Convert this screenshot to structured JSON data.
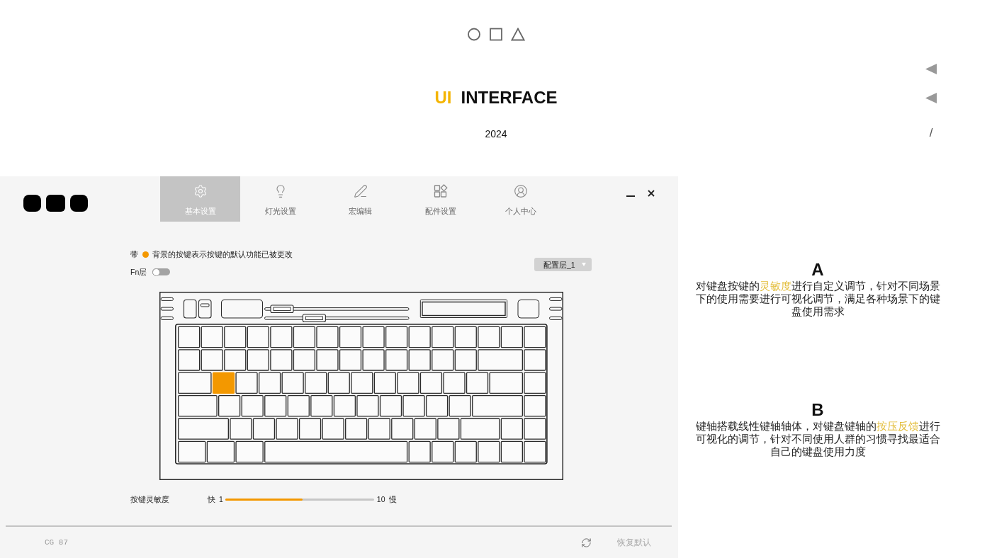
{
  "header": {
    "title_accent": "UI",
    "title": "INTERFACE",
    "year": "2024",
    "side_mark": "/"
  },
  "app": {
    "tabs": [
      {
        "label": "基本设置",
        "selected": true
      },
      {
        "label": "灯光设置",
        "selected": false
      },
      {
        "label": "宏编辑",
        "selected": false
      },
      {
        "label": "配件设置",
        "selected": false
      },
      {
        "label": "个人中心",
        "selected": false
      }
    ],
    "legend": {
      "prefix": "带",
      "text": "背景的按键表示按键的默认功能已被更改"
    },
    "fn_layer": {
      "label": "Fn层",
      "on": false
    },
    "profile_select": {
      "value": "配置层_1"
    },
    "keyboard": {
      "rows": [
        {
          "keys": [
            {
              "modified": false
            },
            {
              "modified": false
            },
            {
              "modified": false
            },
            {
              "modified": false
            },
            {
              "modified": false
            },
            {
              "modified": false
            },
            {
              "modified": false
            },
            {
              "modified": false
            },
            {
              "modified": false
            },
            {
              "modified": false
            },
            {
              "modified": false
            },
            {
              "modified": false
            },
            {
              "modified": false
            },
            {
              "modified": false
            },
            {
              "modified": false
            },
            {
              "modified": false
            }
          ]
        },
        {
          "keys": [
            {
              "modified": false
            },
            {
              "modified": false
            },
            {
              "modified": false
            },
            {
              "modified": false
            },
            {
              "modified": false
            },
            {
              "modified": false
            },
            {
              "modified": false
            },
            {
              "modified": false
            },
            {
              "modified": false
            },
            {
              "modified": false
            },
            {
              "modified": false
            },
            {
              "modified": false
            },
            {
              "modified": false
            },
            {
              "modified": false
            },
            {
              "modified": false
            }
          ]
        },
        {
          "keys": [
            {
              "modified": false
            },
            {
              "modified": true
            },
            {
              "modified": false
            },
            {
              "modified": false
            },
            {
              "modified": false
            },
            {
              "modified": false
            },
            {
              "modified": false
            },
            {
              "modified": false
            },
            {
              "modified": false
            },
            {
              "modified": false
            },
            {
              "modified": false
            },
            {
              "modified": false
            },
            {
              "modified": false
            },
            {
              "modified": false
            },
            {
              "modified": false
            }
          ]
        },
        {
          "keys": [
            {
              "modified": false
            },
            {
              "modified": false
            },
            {
              "modified": false
            },
            {
              "modified": false
            },
            {
              "modified": false
            },
            {
              "modified": false
            },
            {
              "modified": false
            },
            {
              "modified": false
            },
            {
              "modified": false
            },
            {
              "modified": false
            },
            {
              "modified": false
            },
            {
              "modified": false
            },
            {
              "modified": false
            },
            {
              "modified": false
            }
          ]
        },
        {
          "keys": [
            {
              "modified": false
            },
            {
              "modified": false
            },
            {
              "modified": false
            },
            {
              "modified": false
            },
            {
              "modified": false
            },
            {
              "modified": false
            },
            {
              "modified": false
            },
            {
              "modified": false
            },
            {
              "modified": false
            },
            {
              "modified": false
            },
            {
              "modified": false
            },
            {
              "modified": false
            },
            {
              "modified": false
            },
            {
              "modified": false
            }
          ]
        },
        {
          "keys": [
            {
              "modified": false
            },
            {
              "modified": false
            },
            {
              "modified": false
            },
            {
              "modified": false
            },
            {
              "modified": false
            },
            {
              "modified": false
            },
            {
              "modified": false
            },
            {
              "modified": false
            },
            {
              "modified": false
            },
            {
              "modified": false
            }
          ]
        }
      ]
    },
    "sensitivity": {
      "label": "按键灵敏度",
      "fast_label": "快",
      "min": "1",
      "level": 0.52,
      "max": "10",
      "slow_label": "慢"
    },
    "footer": {
      "model": "CG 87",
      "reset_label": "恢复默认"
    }
  },
  "notes": [
    {
      "letter": "A",
      "text_parts": [
        {
          "text": "对键盘按键的",
          "highlight": false
        },
        {
          "text": "灵敏度",
          "highlight": true
        },
        {
          "text": "进行自定义调节，针对不同场景下的使用需要进行可视化调节，满足各种场景下的键盘使用需求",
          "highlight": false
        }
      ]
    },
    {
      "letter": "B",
      "text_parts": [
        {
          "text": "键轴搭载线性键轴轴体，对键盘键轴的",
          "highlight": false
        },
        {
          "text": "按压反馈",
          "highlight": true
        },
        {
          "text": "进行可视化的调节，针对不同使用人群的习惯寻找最适合自己的键盘使用力度",
          "highlight": false
        }
      ]
    }
  ]
}
